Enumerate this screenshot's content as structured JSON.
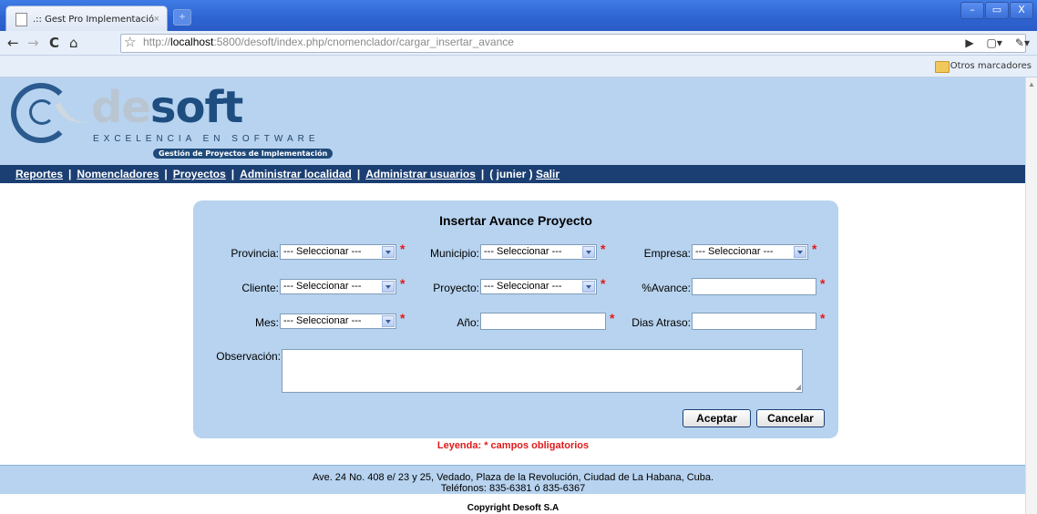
{
  "browser": {
    "tab_title": ".:: Gest Pro Implementació...",
    "tab_close": "×",
    "new_tab": "+",
    "url_prefix": "http://",
    "url_host": "localhost",
    "url_rest": ":5800/desoft/index.php/cnomenclador/cargar_insertar_avance",
    "bookmarks_label": "Otros marcadores",
    "window_buttons": [
      "–",
      "▭",
      "X"
    ],
    "nav_back": "←",
    "nav_forward": "→",
    "nav_reload": "C",
    "nav_home": "⌂",
    "star": "☆",
    "tool_play": "▶",
    "tool_page": "▢▾",
    "tool_wrench": "✎▾"
  },
  "header": {
    "brand_de": "de",
    "brand_soft": "soft",
    "tagline": "EXCELENCIA EN SOFTWARE",
    "subtitle": "Gestión de Proyectos de Implementación"
  },
  "nav": {
    "items": [
      "Reportes",
      "Nomencladores",
      "Proyectos",
      "Administrar localidad",
      "Administrar usuarios"
    ],
    "user": "( junier )",
    "logout": "Salir",
    "separator": "|"
  },
  "form": {
    "title": "Insertar Avance Proyecto",
    "select_placeholder": "--- Seleccionar ---",
    "required_mark": "*",
    "labels": {
      "provincia": "Provincia:",
      "municipio": "Municipio:",
      "empresa": "Empresa:",
      "cliente": "Cliente:",
      "proyecto": "Proyecto:",
      "avance": "%Avance:",
      "mes": "Mes:",
      "anio": "Año:",
      "dias_atraso": "Dias Atraso:",
      "observacion": "Observación:"
    },
    "accept_label": "Aceptar",
    "cancel_label": "Cancelar"
  },
  "legend": {
    "label": "Leyenda:",
    "text": "* campos obligatorios"
  },
  "footer": {
    "address": "Ave. 24 No. 408 e/ 23 y 25, Vedado, Plaza de la Revolución, Ciudad de La Habana, Cuba.",
    "phones": "Teléfonos: 835-6381 ó 835-6367",
    "copyright": "Copyright Desoft S.A"
  }
}
